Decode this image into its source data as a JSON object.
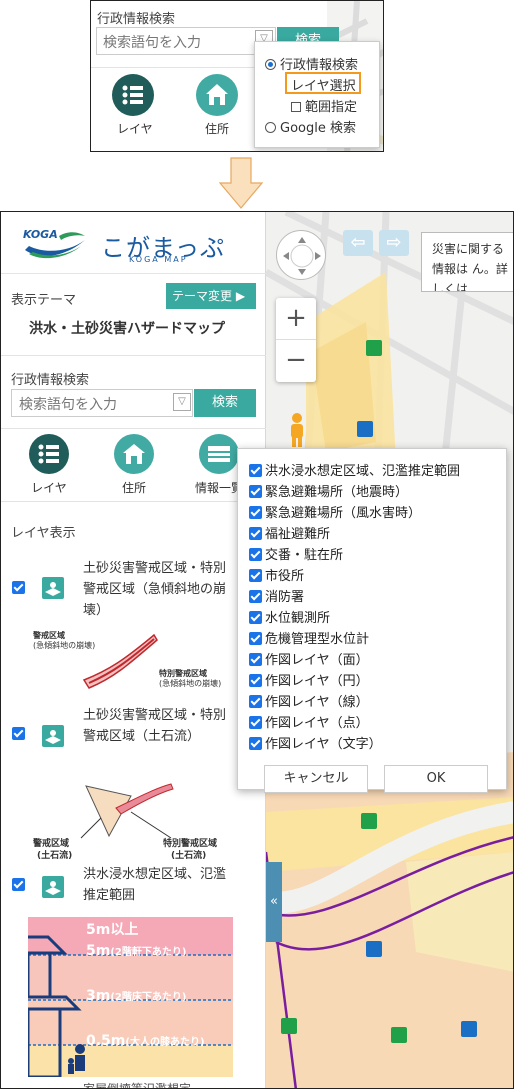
{
  "inset": {
    "section_label": "行政情報検索",
    "search_placeholder": "検索語句を入力",
    "search_button": "検索",
    "icons": [
      {
        "label": "レイヤ"
      },
      {
        "label": "住所"
      }
    ],
    "radio_options": [
      {
        "label": "行政情報検索",
        "selected": true
      },
      {
        "label": "レイヤ選択",
        "selected": false,
        "highlighted": true
      },
      {
        "label": "範囲指定",
        "type": "checkbox"
      },
      {
        "label": "Google 検索",
        "selected": false
      }
    ]
  },
  "sidebar": {
    "logo_brand": "KOGA",
    "logo_title": "こがまっぷ",
    "logo_subtitle": "KOGA MAP",
    "theme_label": "表示テーマ",
    "theme_button": "テーマ変更 ▶",
    "theme_title": "洪水・土砂災害ハザードマップ",
    "search_label": "行政情報検索",
    "search_placeholder": "検索語句を入力",
    "search_button": "検索",
    "icons": [
      {
        "label": "レイヤ"
      },
      {
        "label": "住所"
      },
      {
        "label": "情報一覧"
      }
    ],
    "layer_section_title": "レイヤ表示",
    "layers": [
      {
        "label": "土砂災害警戒区域・特別警戒区域（急傾斜地の崩壊）",
        "checked": true
      },
      {
        "label": "土砂災害警戒区域・特別警戒区域（土石流）",
        "checked": true
      },
      {
        "label": "洪水浸水想定区域、氾濫推定範囲",
        "checked": true
      }
    ],
    "legend1": {
      "a": "警戒区域",
      "a2": "(急傾斜地の崩壊)",
      "b": "特別警戒区域",
      "b2": "(急傾斜地の崩壊)"
    },
    "legend2": {
      "a": "警戒区域",
      "a2": "(土石流)",
      "b": "特別警戒区域",
      "b2": "(土石流)"
    },
    "flood_legend": [
      {
        "text": "5m以上"
      },
      {
        "text": "5m",
        "note": "(2階軒下あたり)"
      },
      {
        "text": "3m",
        "note": "(2階床下あたり)"
      },
      {
        "text": "0.5m",
        "note": "(大人の膝あたり)"
      }
    ],
    "partial_next": "家屋倒壊等氾濫想定"
  },
  "map": {
    "notice": "災害に関する情報は ん。詳しくは"
  },
  "layer_popup": {
    "items": [
      {
        "label": "洪水浸水想定区域、氾濫推定範囲",
        "checked": true
      },
      {
        "label": "緊急避難場所（地震時）",
        "checked": true
      },
      {
        "label": "緊急避難場所（風水害時）",
        "checked": true
      },
      {
        "label": "福祉避難所",
        "checked": true
      },
      {
        "label": "交番・駐在所",
        "checked": true
      },
      {
        "label": "市役所",
        "checked": true
      },
      {
        "label": "消防署",
        "checked": true
      },
      {
        "label": "水位観測所",
        "checked": true
      },
      {
        "label": "危機管理型水位計",
        "checked": true
      },
      {
        "label": "作図レイヤ（面）",
        "checked": true
      },
      {
        "label": "作図レイヤ（円）",
        "checked": true
      },
      {
        "label": "作図レイヤ（線）",
        "checked": true
      },
      {
        "label": "作図レイヤ（点）",
        "checked": true
      },
      {
        "label": "作図レイヤ（文字）",
        "checked": true
      }
    ],
    "cancel_button": "キャンセル",
    "ok_button": "OK"
  },
  "colors": {
    "teal": "#3aa99f",
    "dark_teal": "#1f5c5a",
    "checkbox_blue": "#1a73e8",
    "highlight_orange": "#f39a1e",
    "flood_pink": "#f7c9c3",
    "flood_yellow": "#fbe9a6"
  }
}
